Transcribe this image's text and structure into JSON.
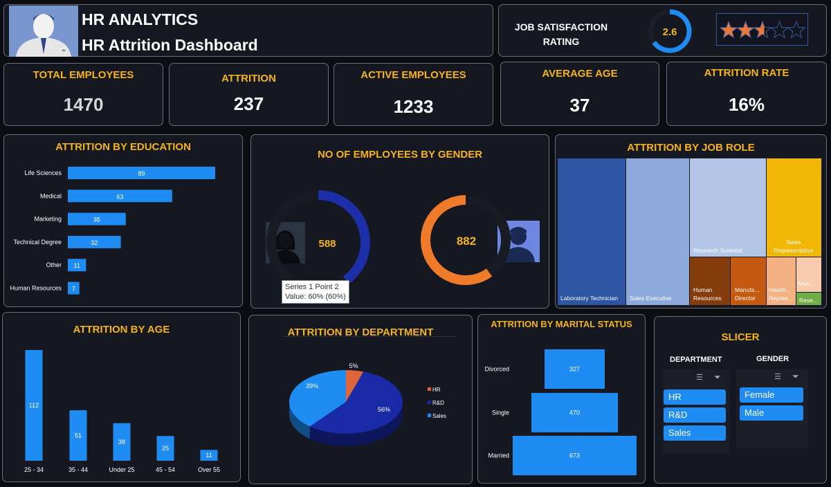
{
  "header": {
    "title": "HR ANALYTICS",
    "subtitle": "HR Attrition Dashboard",
    "avatar_badge": "HR",
    "rating_label_line1": "JOB SATISFACTION",
    "rating_label_line2": "RATING",
    "rating_value": "2.6",
    "rating_fraction": 0.65,
    "stars_filled": 2.6,
    "stars_total": 5
  },
  "kpis": [
    {
      "title": "TOTAL EMPLOYEES",
      "value": "1470"
    },
    {
      "title": "ATTRITION",
      "value": "237"
    },
    {
      "title": "ACTIVE EMPLOYEES",
      "value": "1233"
    },
    {
      "title": "AVERAGE AGE",
      "value": "37"
    },
    {
      "title": "ATTRITION RATE",
      "value": "16%"
    }
  ],
  "titles": {
    "education": "ATTRITION BY EDUCATION",
    "gender": "NO OF EMPLOYEES BY GENDER",
    "jobrole": "ATTRITION BY JOB ROLE",
    "age": "ATTRITION BY AGE",
    "department": "ATTRITION BY DEPARTMENT",
    "marital": "ATTRITION BY MARITAL STATUS",
    "slicer": "SLICER"
  },
  "tooltip": {
    "line1": "Series 1 Point 2",
    "line2": "Value: 60% (60%)"
  },
  "slicer": {
    "department_label": "DEPARTMENT",
    "department_items": [
      "HR",
      "R&D",
      "Sales"
    ],
    "gender_label": "GENDER",
    "gender_items": [
      "Female",
      "Male"
    ]
  },
  "colors": {
    "accent": "#f5b31c",
    "bar": "#1e8cf2",
    "female_ring": "#1c2fa8",
    "male_ring": "#ef7b2a"
  },
  "chart_data": [
    {
      "id": "education",
      "type": "bar",
      "orientation": "horizontal",
      "title": "ATTRITION BY EDUCATION",
      "categories": [
        "Life Sciences",
        "Medical",
        "Marketing",
        "Technical Degree",
        "Other",
        "Human Resources"
      ],
      "values": [
        89,
        63,
        35,
        32,
        11,
        7
      ]
    },
    {
      "id": "gender",
      "type": "pie",
      "title": "NO OF EMPLOYEES BY GENDER",
      "categories": [
        "Female",
        "Male"
      ],
      "values": [
        588,
        882
      ],
      "ring_fraction": [
        0.4,
        0.6
      ]
    },
    {
      "id": "jobrole",
      "type": "treemap",
      "title": "ATTRITION BY JOB ROLE",
      "categories": [
        "Laboratory Technician",
        "Sales Executive",
        "Research Scientist",
        "Sales Representative",
        "Human Resources",
        "Manufa... Director",
        "Health... Repres...",
        "Man...",
        "Rese..."
      ],
      "colors": [
        "#2e55a2",
        "#8eaadc",
        "#b4c6e7",
        "#f2b705",
        "#843c0c",
        "#c55a11",
        "#f4b183",
        "#f8cbad",
        "#70ad47"
      ]
    },
    {
      "id": "age",
      "type": "bar",
      "title": "ATTRITION BY AGE",
      "categories": [
        "25 - 34",
        "35 - 44",
        "Under 25",
        "45 - 54",
        "Over 55"
      ],
      "values": [
        112,
        51,
        38,
        25,
        11
      ]
    },
    {
      "id": "department",
      "type": "pie",
      "title": "ATTRITION BY DEPARTMENT",
      "categories": [
        "HR",
        "R&D",
        "Sales"
      ],
      "values": [
        5,
        56,
        39
      ],
      "labels": [
        "5%",
        "56%",
        "39%"
      ],
      "colors": [
        "#e0653a",
        "#1a2aa6",
        "#1e8cf2"
      ]
    },
    {
      "id": "marital",
      "type": "bar",
      "orientation": "funnel",
      "title": "ATTRITION BY MARITAL STATUS",
      "categories": [
        "Divorced",
        "Single",
        "Married"
      ],
      "values": [
        327,
        470,
        673
      ]
    }
  ]
}
